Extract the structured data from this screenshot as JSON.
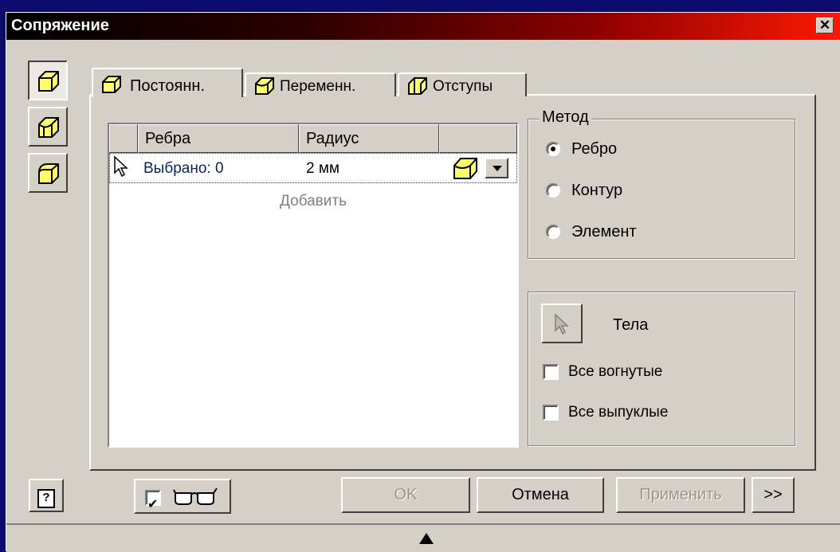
{
  "window": {
    "title": "Сопряжение",
    "close_glyph": "✕"
  },
  "modes": [
    "constant-fillet-icon",
    "variable-fillet-icon",
    "setback-fillet-icon"
  ],
  "tabs": [
    {
      "label": "Постоянн.",
      "icon": "constant-fillet-icon",
      "active": true
    },
    {
      "label": "Переменн.",
      "icon": "variable-fillet-icon",
      "active": false
    },
    {
      "label": "Отступы",
      "icon": "setback-fillet-icon",
      "active": false
    }
  ],
  "table": {
    "headers": [
      "Ребра",
      "Радиус"
    ],
    "row": {
      "edges": "Выбрано: 0",
      "radius": "2 мм"
    },
    "add_label": "Добавить"
  },
  "method": {
    "legend": "Метод",
    "options": [
      {
        "label": "Ребро",
        "selected": true
      },
      {
        "label": "Контур",
        "selected": false
      },
      {
        "label": "Элемент",
        "selected": false
      }
    ]
  },
  "bodies": {
    "label": "Тела",
    "all_concave": {
      "label": "Все вогнутые",
      "checked": false
    },
    "all_convex": {
      "label": "Все выпуклые",
      "checked": false
    }
  },
  "footer": {
    "help_glyph": "?",
    "preview_checked": true,
    "ok_label": "OK",
    "cancel_label": "Отмена",
    "apply_label": "Применить",
    "more_label": ">>"
  },
  "colors": {
    "title_start": "#000000",
    "title_end": "#ff1800",
    "link_text": "#0a246a",
    "icon_fill": "#ffff66"
  }
}
